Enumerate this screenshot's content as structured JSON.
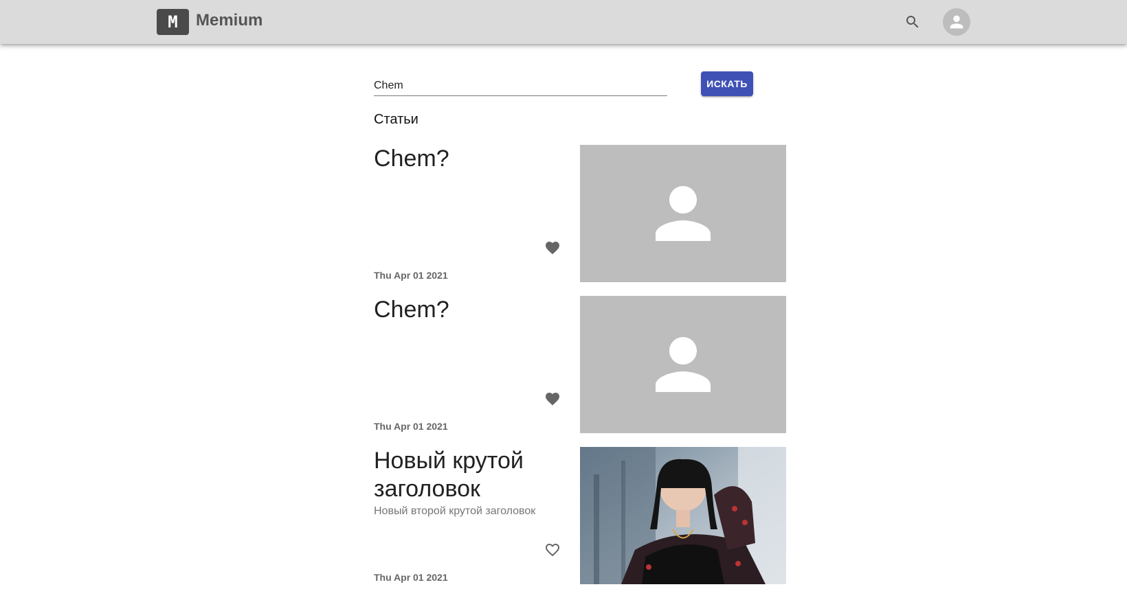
{
  "header": {
    "logo_letter": "M",
    "brand": "Memium",
    "search_icon": "search-icon",
    "account_icon": "person-icon"
  },
  "search": {
    "value": "Chem",
    "button_label": "ИСКАТЬ"
  },
  "section_title": "Статьи",
  "articles": [
    {
      "title": "Chem?",
      "subtitle": "",
      "date": "Thu Apr 01 2021",
      "liked": true,
      "image": "placeholder-person"
    },
    {
      "title": "Chem?",
      "subtitle": "",
      "date": "Thu Apr 01 2021",
      "liked": true,
      "image": "placeholder-person"
    },
    {
      "title": "Новый крутой заголовок",
      "subtitle": "Новый второй крутой заголовок",
      "date": "Thu Apr 01 2021",
      "liked": false,
      "image": "photo"
    }
  ],
  "colors": {
    "appbar": "#dcdbdc",
    "primary": "#3f51b5",
    "placeholder": "#bdbdbd"
  }
}
